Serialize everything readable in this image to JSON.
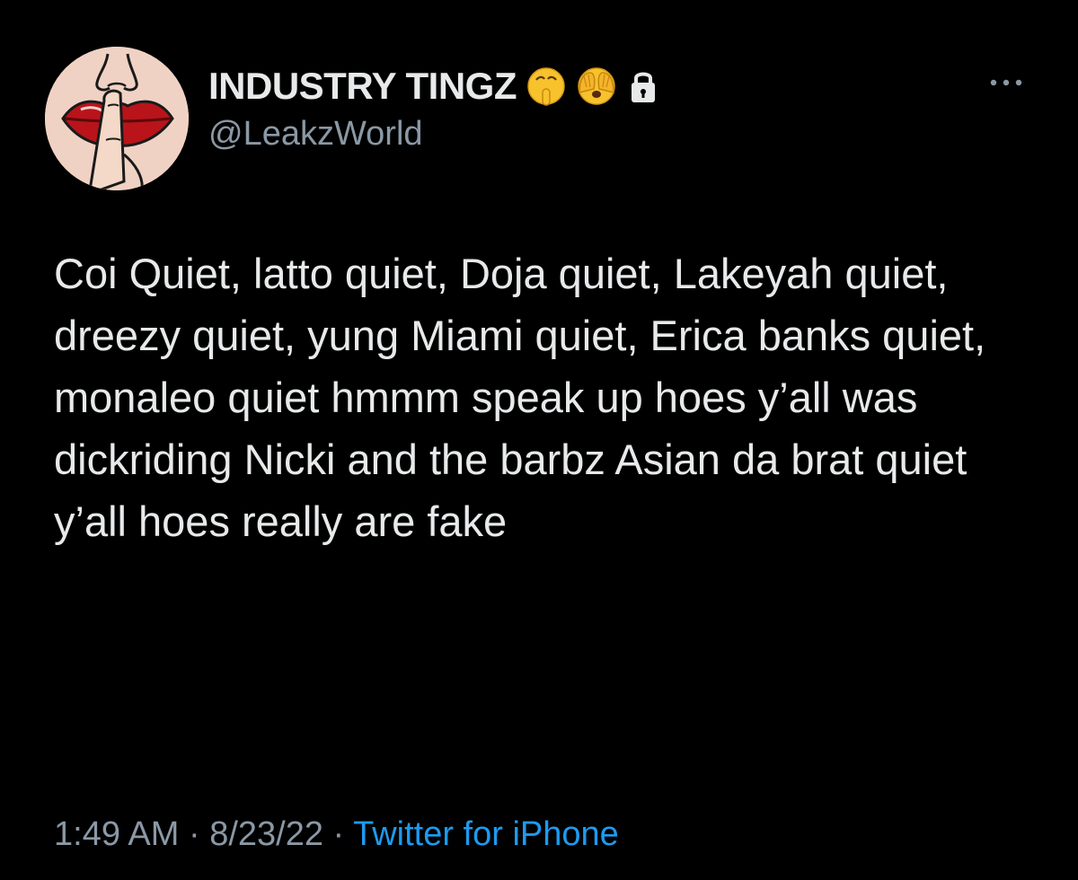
{
  "account": {
    "display_name": "INDUSTRY TINGZ",
    "handle": "@LeakzWorld",
    "badges": [
      "shushing-face-emoji",
      "face-with-hands-over-eyes-emoji",
      "lock-icon"
    ]
  },
  "tweet": {
    "text": "Coi Quiet, latto quiet, Doja quiet, Lakeyah quiet, dreezy quiet, yung Miami quiet, Erica banks quiet, monaleo quiet hmmm speak up hoes y’all was dickriding Nicki and the barbz Asian da brat quiet  y’all hoes really are fake"
  },
  "meta": {
    "time": "1:49 AM",
    "separator": " · ",
    "date": "8/23/22",
    "source": "Twitter for iPhone"
  },
  "colors": {
    "background": "#000000",
    "primary_text": "#e7e9ea",
    "secondary_text": "#8b98a5",
    "link": "#1d9bf0"
  }
}
